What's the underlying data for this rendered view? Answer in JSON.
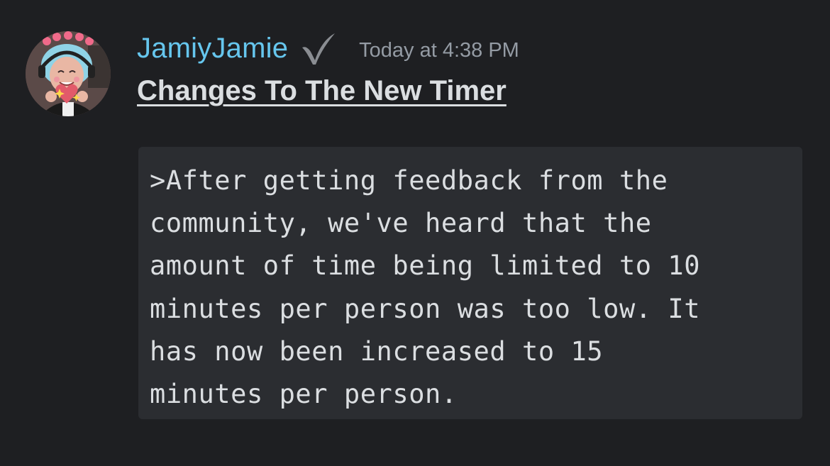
{
  "message": {
    "author": "JamiyJamie",
    "timestamp": "Today at 4:38 PM",
    "title": "Changes To The New Timer",
    "code_lines": [
      ">After getting feedback from the",
      "community, we've heard that the",
      "amount of time being limited to 10",
      "minutes per person was too low. It",
      "has now been increased to 15",
      "minutes per person."
    ]
  },
  "icons": {
    "badge": "checkmark-icon",
    "avatar": "user-avatar"
  },
  "colors": {
    "background": "#1e1f22",
    "username": "#66c6ee",
    "timestamp": "#949ba4",
    "text": "#dbdee1",
    "codeblock_bg": "#2b2d31"
  }
}
